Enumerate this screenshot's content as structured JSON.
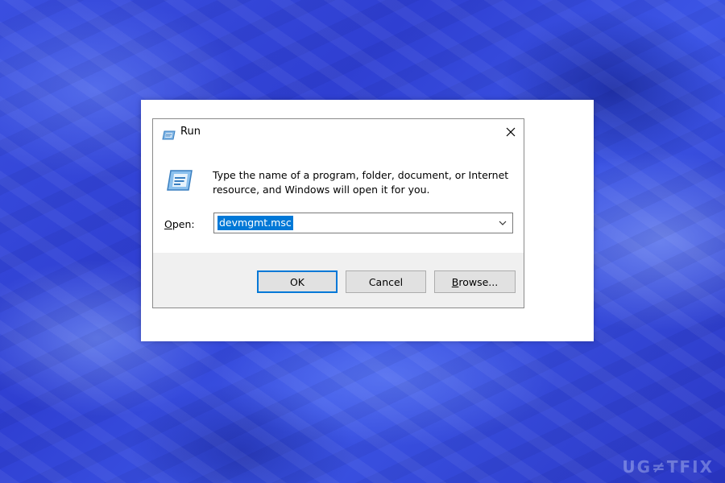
{
  "dialog": {
    "title": "Run",
    "description_line1": "Type the name of a program, folder, document, or Internet",
    "description_line2": "resource, and Windows will open it for you.",
    "open_label_accel": "O",
    "open_label_rest": "pen:",
    "open_value": "devmgmt.msc",
    "buttons": {
      "ok": "OK",
      "cancel": "Cancel",
      "browse_accel": "B",
      "browse_rest": "rowse..."
    }
  },
  "watermark": "UG≠TFIX",
  "icons": {
    "title": "run-app-icon",
    "big": "run-app-icon",
    "close": "close-icon",
    "dropdown": "chevron-down-icon"
  },
  "colors": {
    "selection": "#0078d7",
    "background": "#3246d8"
  }
}
